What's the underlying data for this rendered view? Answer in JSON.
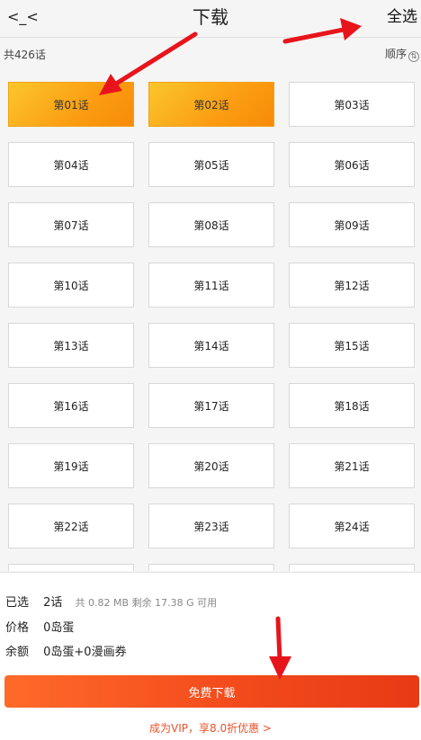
{
  "header": {
    "back_icon": "back-arrow-icon",
    "back_glyph": "<_<",
    "title": "下载",
    "select_all": "全选"
  },
  "subbar": {
    "total": "共426话",
    "order": "顺序",
    "order_icon_glyph": "⇅"
  },
  "episodes": [
    {
      "label": "第01话",
      "selected": true
    },
    {
      "label": "第02话",
      "selected": true
    },
    {
      "label": "第03话",
      "selected": false
    },
    {
      "label": "第04话",
      "selected": false
    },
    {
      "label": "第05话",
      "selected": false
    },
    {
      "label": "第06话",
      "selected": false
    },
    {
      "label": "第07话",
      "selected": false
    },
    {
      "label": "第08话",
      "selected": false
    },
    {
      "label": "第09话",
      "selected": false
    },
    {
      "label": "第10话",
      "selected": false
    },
    {
      "label": "第11话",
      "selected": false
    },
    {
      "label": "第12话",
      "selected": false
    },
    {
      "label": "第13话",
      "selected": false
    },
    {
      "label": "第14话",
      "selected": false
    },
    {
      "label": "第15话",
      "selected": false
    },
    {
      "label": "第16话",
      "selected": false
    },
    {
      "label": "第17话",
      "selected": false
    },
    {
      "label": "第18话",
      "selected": false
    },
    {
      "label": "第19话",
      "selected": false
    },
    {
      "label": "第20话",
      "selected": false
    },
    {
      "label": "第21话",
      "selected": false
    },
    {
      "label": "第22话",
      "selected": false
    },
    {
      "label": "第23话",
      "selected": false
    },
    {
      "label": "第24话",
      "selected": false
    },
    {
      "label": "",
      "selected": false
    },
    {
      "label": "",
      "selected": false
    },
    {
      "label": "",
      "selected": false
    }
  ],
  "summary": {
    "selected_label": "已选",
    "selected_count": "2话",
    "size_info": "共 0.82 MB  剩余 17.38 G 可用",
    "price_label": "价格",
    "price_value": "0岛蛋",
    "balance_label": "余额",
    "balance_value": "0岛蛋+0漫画券"
  },
  "download_button": "免费下载",
  "vip_link": "成为VIP，享8.0折优惠 >",
  "colors": {
    "selected_gradient_start": "#fbc62a",
    "selected_gradient_end": "#f78b08",
    "download_button": "#f34b1c",
    "vip_text": "#e8532a",
    "annotation_arrow": "#e8141c"
  }
}
